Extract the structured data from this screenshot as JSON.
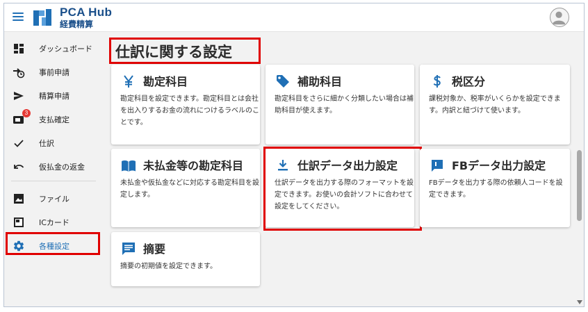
{
  "header": {
    "brand_name": "PCA Hub",
    "brand_sub": "経費精算",
    "brand_color": "#1a4f8a",
    "accent_color": "#1f6fb5"
  },
  "sidebar": {
    "items": [
      {
        "label": "ダッシュボード",
        "icon": "dashboard-icon"
      },
      {
        "label": "事前申請",
        "icon": "pre-application-icon"
      },
      {
        "label": "精算申請",
        "icon": "send-icon"
      },
      {
        "label": "支払確定",
        "icon": "payment-confirm-icon",
        "badge": "3"
      },
      {
        "label": "仕訳",
        "icon": "check-icon"
      },
      {
        "label": "仮払金の返金",
        "icon": "undo-icon"
      },
      {
        "label": "ファイル",
        "icon": "image-icon"
      },
      {
        "label": "ICカード",
        "icon": "ic-card-icon"
      },
      {
        "label": "各種設定",
        "icon": "gear-icon",
        "active": true
      }
    ]
  },
  "main": {
    "title": "仕訳に関する設定",
    "cards": [
      {
        "title": "勘定科目",
        "icon": "yen-icon",
        "desc": "勘定科目を設定できます。勘定科目とは会社を出入りするお金の流れにつけるラベルのことです。"
      },
      {
        "title": "補助科目",
        "icon": "tag-icon",
        "desc": "勘定科目をさらに細かく分類したい場合は補助科目が使えます。"
      },
      {
        "title": "税区分",
        "icon": "dollar-icon",
        "desc": "課税対象か、税率がいくらかを設定できます。内訳と紐づけて使います。"
      },
      {
        "title": "未払金等の勘定科目",
        "icon": "book-icon",
        "desc": "未払金や仮払金などに対応する勘定科目を設定します。"
      },
      {
        "title": "仕訳データ出力設定",
        "icon": "download-icon",
        "desc": "仕訳データを出力する際のフォーマットを設定できます。お使いの会計ソフトに合わせて設定をしてください。"
      },
      {
        "title": "FBデータ出力設定",
        "icon": "flag-icon",
        "desc": "FBデータを出力する際の依頼人コードを設定できます。"
      },
      {
        "title": "摘要",
        "icon": "comment-icon",
        "desc": "摘要の初期値を設定できます。"
      }
    ]
  }
}
